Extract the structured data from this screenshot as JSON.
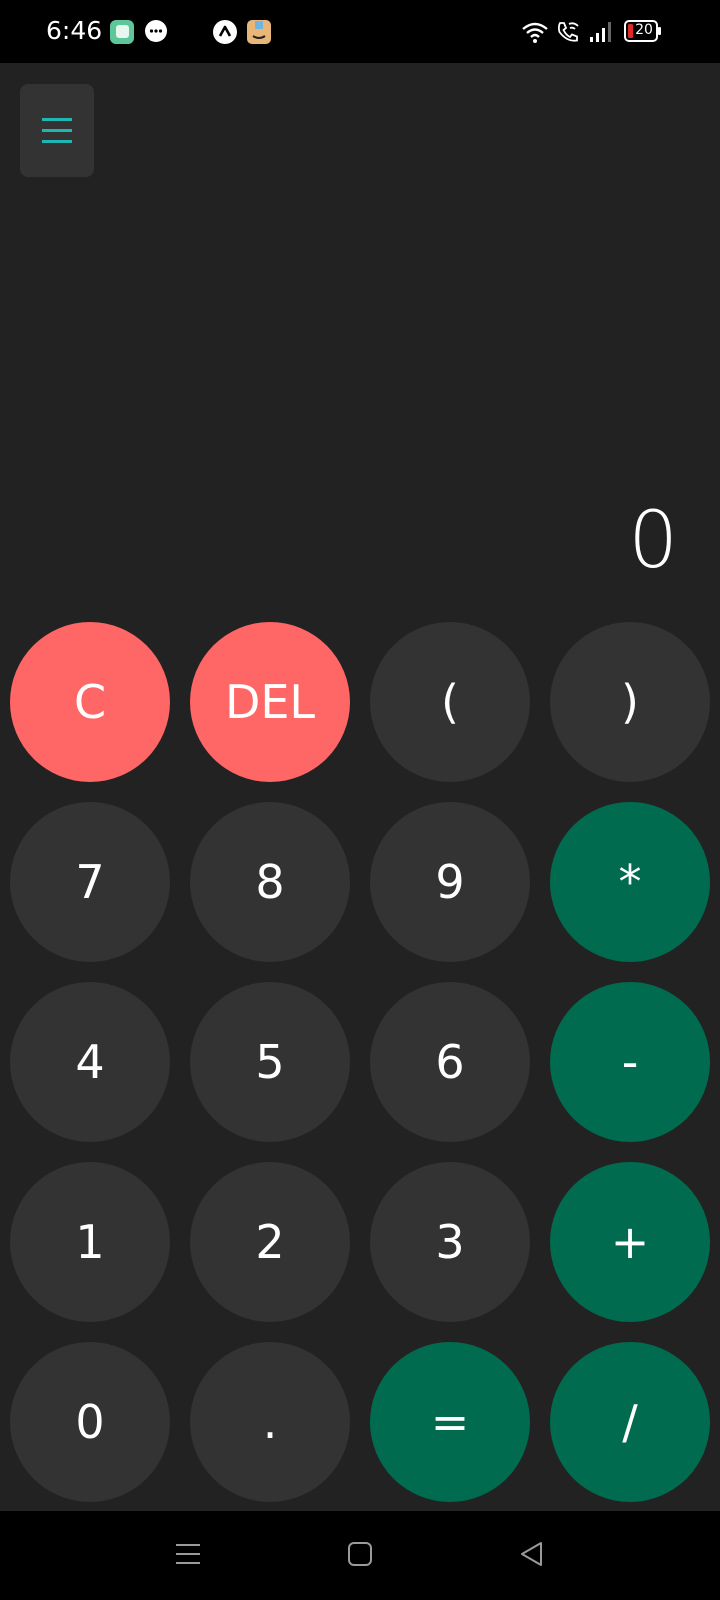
{
  "status_bar": {
    "time": "6:46",
    "battery": "20",
    "icons": [
      "gallery-app-icon",
      "messages-icon",
      "up-arrow-app-icon",
      "amazon-app-icon",
      "wifi-icon",
      "wifi-calling-icon",
      "signal-icon",
      "battery-icon"
    ]
  },
  "calculator": {
    "display": "0",
    "keys": [
      {
        "label": "C",
        "role": "clear-button",
        "style": "red"
      },
      {
        "label": "DEL",
        "role": "delete-button",
        "style": "red"
      },
      {
        "label": "(",
        "role": "open-paren-button",
        "style": "gray"
      },
      {
        "label": ")",
        "role": "close-paren-button",
        "style": "gray"
      },
      {
        "label": "7",
        "role": "digit-7-button",
        "style": "gray"
      },
      {
        "label": "8",
        "role": "digit-8-button",
        "style": "gray"
      },
      {
        "label": "9",
        "role": "digit-9-button",
        "style": "gray"
      },
      {
        "label": "*",
        "role": "multiply-button",
        "style": "green"
      },
      {
        "label": "4",
        "role": "digit-4-button",
        "style": "gray"
      },
      {
        "label": "5",
        "role": "digit-5-button",
        "style": "gray"
      },
      {
        "label": "6",
        "role": "digit-6-button",
        "style": "gray"
      },
      {
        "label": "-",
        "role": "subtract-button",
        "style": "green"
      },
      {
        "label": "1",
        "role": "digit-1-button",
        "style": "gray"
      },
      {
        "label": "2",
        "role": "digit-2-button",
        "style": "gray"
      },
      {
        "label": "3",
        "role": "digit-3-button",
        "style": "gray"
      },
      {
        "label": "+",
        "role": "add-button",
        "style": "green"
      },
      {
        "label": "0",
        "role": "digit-0-button",
        "style": "gray"
      },
      {
        "label": ".",
        "role": "decimal-button",
        "style": "gray"
      },
      {
        "label": "=",
        "role": "equals-button",
        "style": "green"
      },
      {
        "label": "/",
        "role": "divide-button",
        "style": "green"
      }
    ]
  },
  "colors": {
    "background": "#222222",
    "key_gray": "#333333",
    "key_red": "#ff6666",
    "key_green": "#006b4f",
    "menu_accent": "#1fb5b0"
  },
  "nav_bar": {
    "icons": [
      "recents-icon",
      "home-icon",
      "back-icon"
    ]
  }
}
